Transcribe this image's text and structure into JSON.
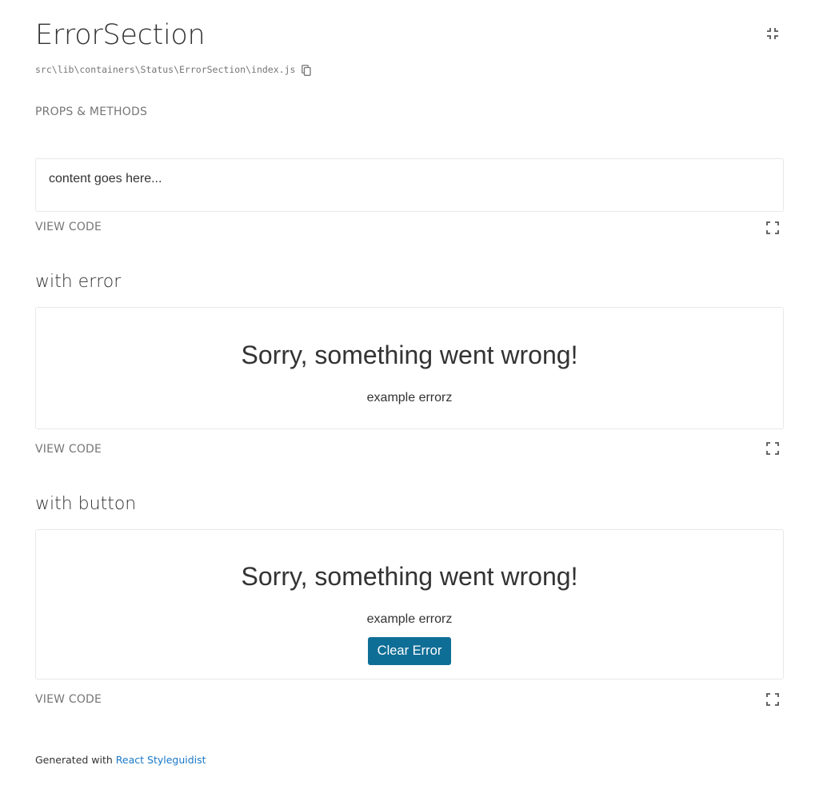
{
  "component": {
    "title": "ErrorSection",
    "path": "src\\lib\\containers\\Status\\ErrorSection\\index.js"
  },
  "props_link": "PROPS & METHODS",
  "examples": [
    {
      "content": "content goes here...",
      "view_code": "VIEW CODE"
    },
    {
      "heading": "with error",
      "error_title": "Sorry, something went wrong!",
      "error_message": "example errorz",
      "view_code": "VIEW CODE"
    },
    {
      "heading": "with button",
      "error_title": "Sorry, something went wrong!",
      "error_message": "example errorz",
      "button_label": "Clear Error",
      "view_code": "VIEW CODE"
    }
  ],
  "footer": {
    "prefix": "Generated with",
    "link": "React Styleguidist"
  },
  "colors": {
    "button_bg": "#0f6e96",
    "link": "#1978c8",
    "muted": "#767676",
    "border": "#e8e8e8"
  },
  "icons": [
    "copy-icon",
    "collapse-icon",
    "fullscreen-icon"
  ]
}
